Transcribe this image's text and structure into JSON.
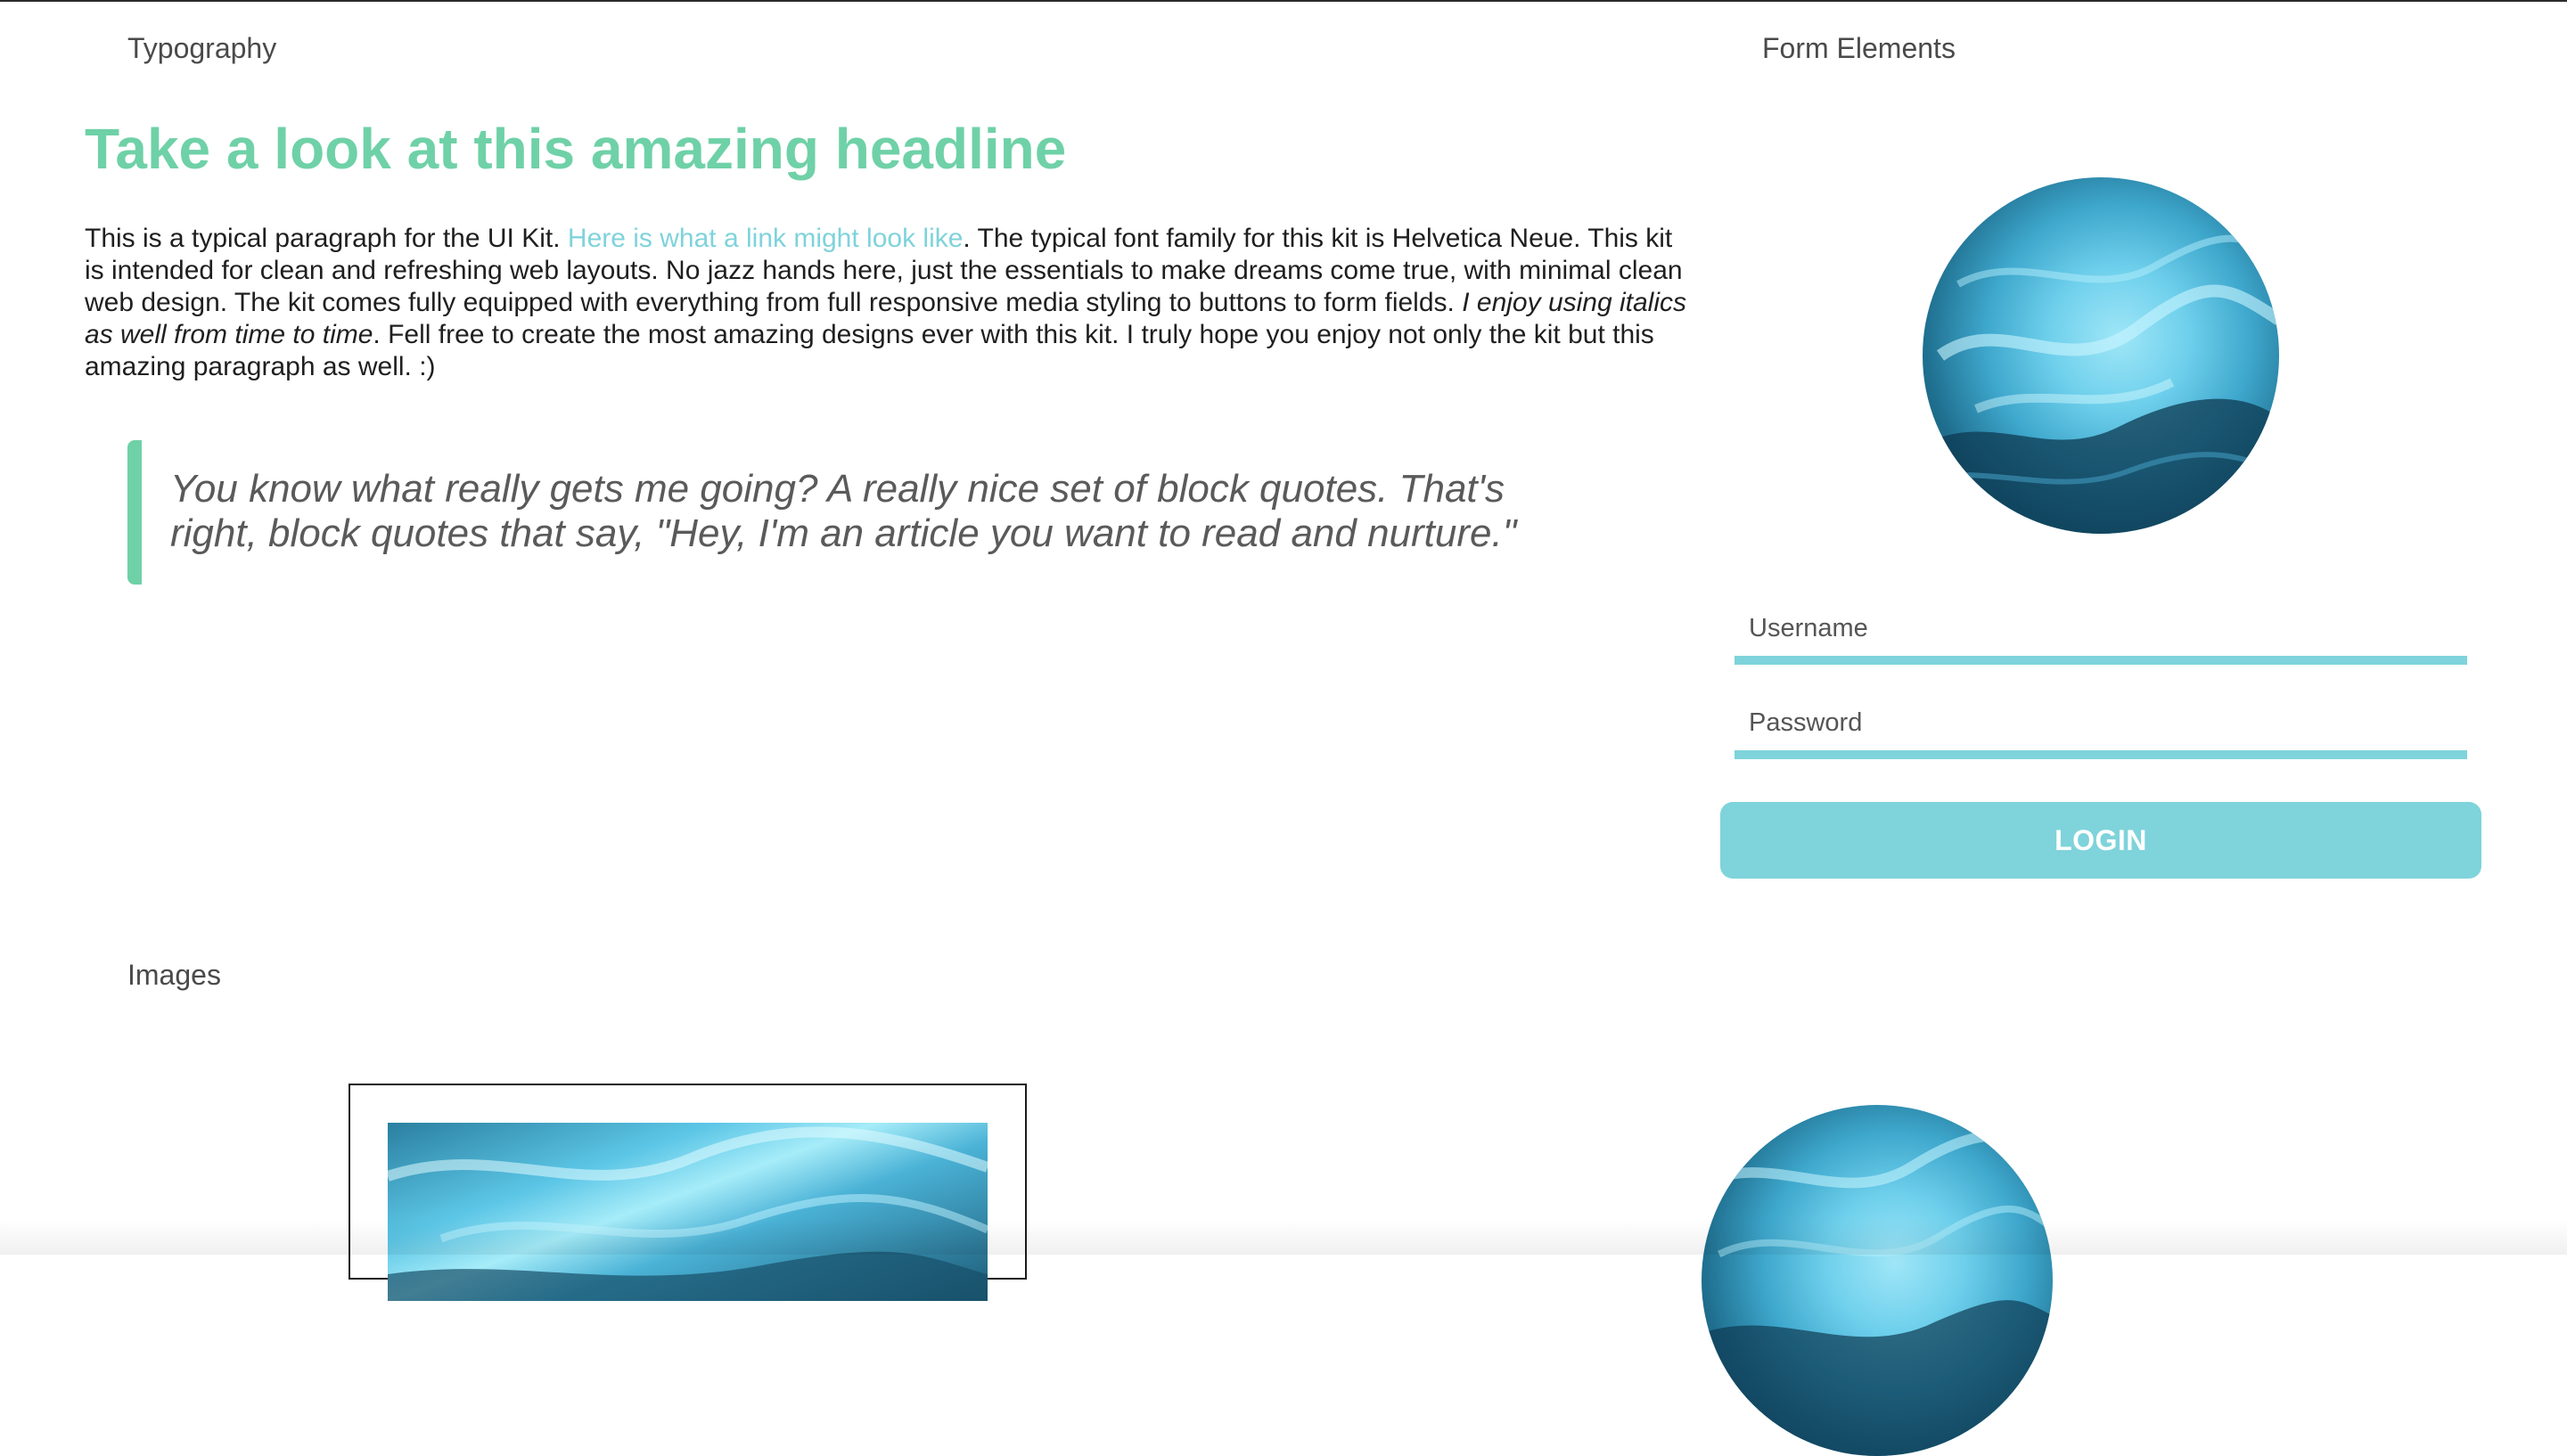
{
  "sections": {
    "typography_label": "Typography",
    "form_label": "Form Elements",
    "images_label": "Images"
  },
  "typography": {
    "headline": "Take a look at this amazing headline",
    "paragraph": {
      "intro": "This is a typical paragraph for the UI Kit. ",
      "link": "Here is what a link might look like",
      "body": ". The typical font family for this kit is Helvetica Neue. This kit is intended for clean and refreshing web layouts. No jazz hands here, just the essentials to make dreams come true, with minimal clean web design. The kit comes fully equipped with everything from full responsive media styling to buttons to form fields. ",
      "italic": "I enjoy using italics as well from time to time",
      "outro": ". Fell free to create the most amazing designs ever with this kit. I truly hope you enjoy not only the kit but this amazing paragraph as well. :)"
    },
    "blockquote": "You know what really gets me going? A really nice set of block quotes. That's right, block quotes that say, \"Hey, I'm an article you want to read and nurture.\""
  },
  "form": {
    "username_placeholder": "Username",
    "password_placeholder": "Password",
    "login_label": "LOGIN"
  },
  "colors": {
    "accent_green": "#6fd1a7",
    "accent_cyan": "#7fd3db"
  },
  "icons": {
    "avatar": "ocean-wave-image"
  }
}
